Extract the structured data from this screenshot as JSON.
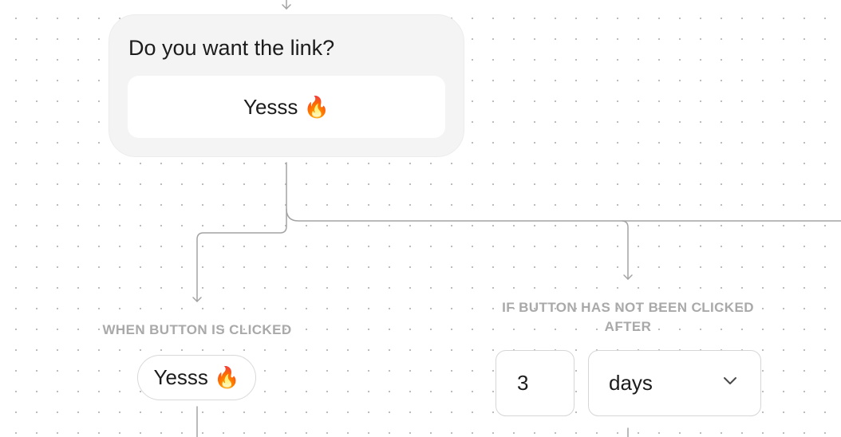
{
  "question_card": {
    "question": "Do you want the link?",
    "button_label": "Yesss 🔥"
  },
  "branches": {
    "clicked": {
      "label": "When button is clicked",
      "button_label": "Yesss 🔥"
    },
    "not_clicked": {
      "label_line1": "If button has not been clicked",
      "label_line2": "after",
      "wait_amount": "3",
      "wait_unit": "days"
    }
  },
  "icons": {
    "dropdown": "chevron-down-icon",
    "connector_arrow": "arrow-down-icon"
  },
  "colors": {
    "connector": "#a3a3a3",
    "label": "#a9a9a9",
    "card_background": "#f4f4f4"
  }
}
